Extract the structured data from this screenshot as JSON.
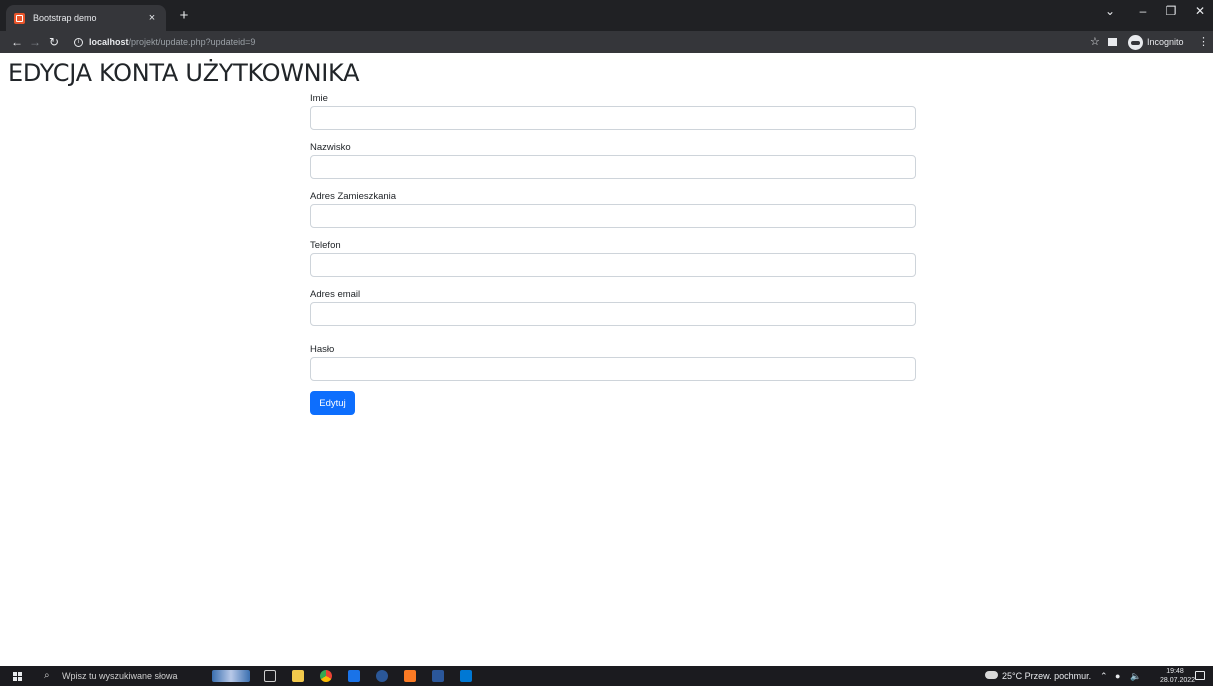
{
  "browser": {
    "tab_title": "Bootstrap demo",
    "tab_close": "×",
    "new_tab": "+",
    "url_host": "localhost",
    "url_path": "/projekt/update.php?updateid=9",
    "incognito_label": "Incognito"
  },
  "page": {
    "title": "EDYCJA KONTA UŻYTKOWNIKA",
    "fields": [
      {
        "label": "Imie",
        "value": "",
        "placeholder": ""
      },
      {
        "label": "Nazwisko",
        "value": "",
        "placeholder": ""
      },
      {
        "label": "Adres Zamieszkania",
        "value": "",
        "placeholder": ""
      },
      {
        "label": "Telefon",
        "value": "",
        "placeholder": ""
      },
      {
        "label": "Adres email",
        "value": "",
        "placeholder": ""
      },
      {
        "label": "Hasło",
        "value": "",
        "placeholder": ""
      }
    ],
    "submit_label": "Edytuj"
  },
  "taskbar": {
    "search_placeholder": "Wpisz tu wyszukiwane słowa",
    "weather": "25°C  Przew. pochmur.",
    "time": "19:48",
    "date": "28.07.2022"
  },
  "colors": {
    "primary_button": "#0d6efd",
    "tab_favicon": "#e8552b"
  }
}
